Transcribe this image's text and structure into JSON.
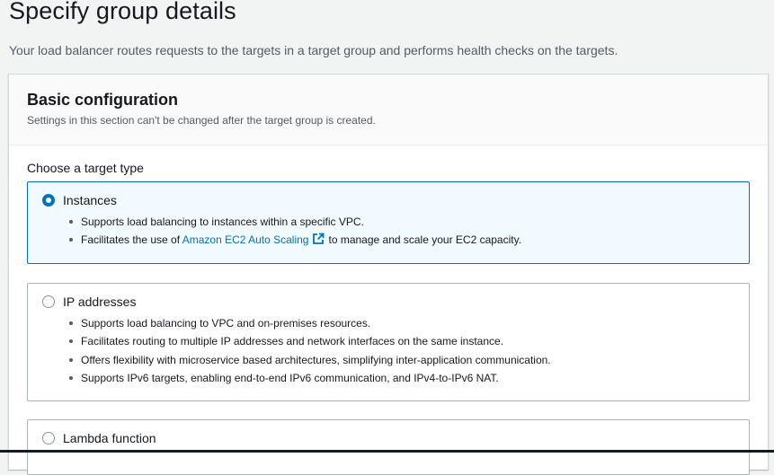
{
  "page": {
    "title": "Specify group details",
    "description": "Your load balancer routes requests to the targets in a target group and performs health checks on the targets."
  },
  "section": {
    "title": "Basic configuration",
    "description": "Settings in this section can't be changed after the target group is created."
  },
  "target_type": {
    "label": "Choose a target type",
    "selected": "Instances",
    "options": [
      {
        "label": "Instances",
        "bullets": [
          "Supports load balancing to instances within a specific VPC.",
          "Facilitates the use of Amazon EC2 Auto Scaling to manage and scale your EC2 capacity."
        ],
        "bullet_parts": {
          "before": "Facilitates the use of",
          "link": "Amazon EC2 Auto Scaling",
          "after": "to manage and scale your EC2 capacity."
        }
      },
      {
        "label": "IP addresses",
        "bullets": [
          "Supports load balancing to VPC and on-premises resources.",
          "Facilitates routing to multiple IP addresses and network interfaces on the same instance.",
          "Offers flexibility with microservice based architectures, simplifying inter-application communication.",
          "Supports IPv6 targets, enabling end-to-end IPv6 communication, and IPv4-to-IPv6 NAT."
        ]
      },
      {
        "label": "Lambda function"
      }
    ]
  },
  "colors": {
    "accent": "#0073bb",
    "selected_tile_bg": "#f1faff",
    "page_bg": "#f2f3f3"
  },
  "icons": {
    "external_link": "external-link-icon"
  }
}
